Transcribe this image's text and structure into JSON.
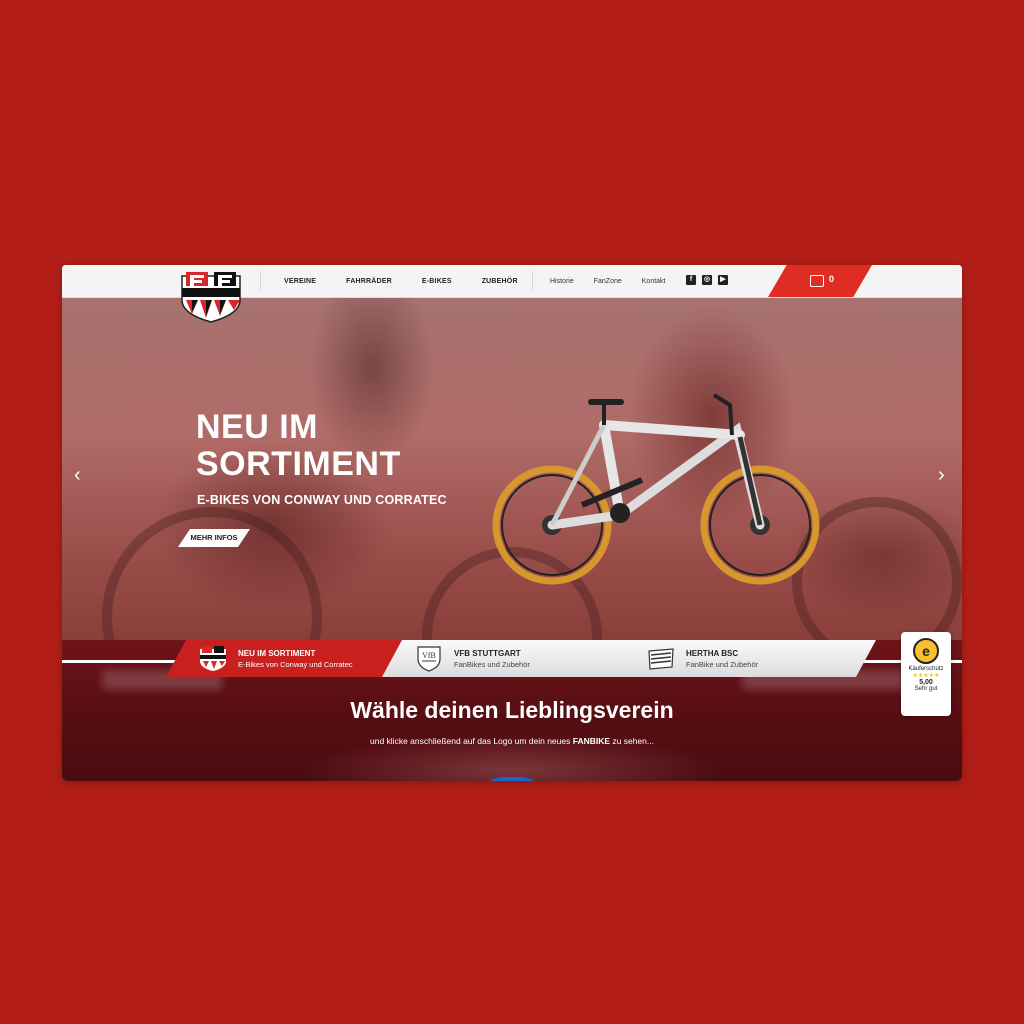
{
  "header": {
    "nav_main": [
      "VEREINE",
      "FAHRRÄDER",
      "E-BIKES",
      "ZUBEHÖR"
    ],
    "nav_secondary": [
      "Historie",
      "FanZone",
      "Kontakt"
    ],
    "logo_text": "FanBike",
    "social_icons": [
      "facebook-icon",
      "instagram-icon",
      "youtube-icon"
    ],
    "cart_count": "0"
  },
  "hero": {
    "title_line1": "NEU IM",
    "title_line2": "SORTIMENT",
    "subtitle": "E-BIKES VON CONWAY UND CORRATEC",
    "button": "MEHR INFOS",
    "prev_arrow": "‹",
    "next_arrow": "›"
  },
  "tabs": [
    {
      "title": "NEU IM SORTIMENT",
      "desc": "E-Bikes von Conway und Corratec"
    },
    {
      "title": "VFB STUTTGART",
      "desc": "FanBikes und Zubehör"
    },
    {
      "title": "HERTHA BSC",
      "desc": "FanBike und Zubehör"
    }
  ],
  "section": {
    "heading": "Wähle deinen Lieblingsverein",
    "intro_pre": "und klicke anschließend auf das Logo um dein neues ",
    "intro_bold": "FANBIKE",
    "intro_post": " zu sehen..."
  },
  "trust_badge": {
    "label": "Käuferschutz",
    "stars": "★★★★★",
    "score": "5,00",
    "verdict": "Sehr gut"
  },
  "colors": {
    "background": "#b31f18",
    "accent": "#e02d23",
    "header": "#f4f4f4"
  }
}
